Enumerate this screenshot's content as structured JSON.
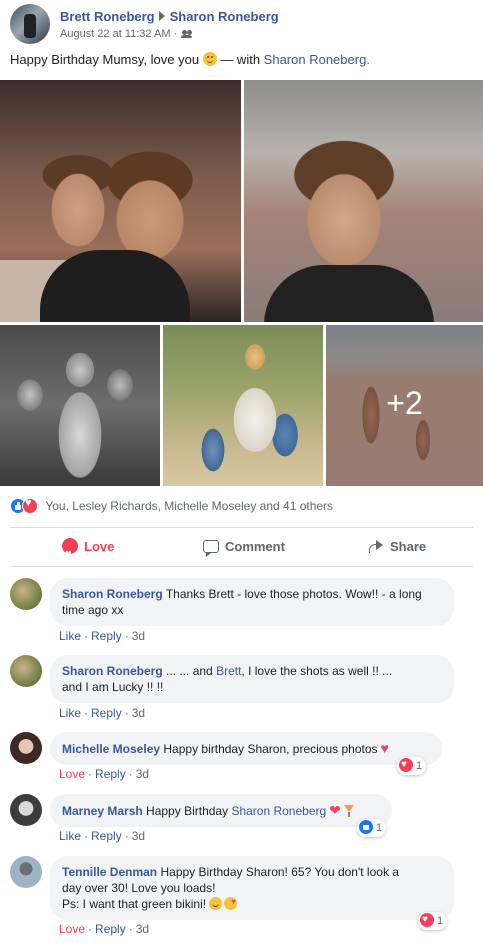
{
  "post": {
    "author": "Brett Roneberg",
    "recipient": "Sharon Roneberg",
    "timestamp": "August 22 at 11:32 AM",
    "audience_icon": "friends-icon",
    "message": "Happy Birthday Mumsy, love you",
    "with_prefix": "— with",
    "tagged": "Sharon Roneberg",
    "tagged_suffix": ".",
    "more_photos": "+2"
  },
  "reactions": {
    "summary": "You, Lesley Richards, Michelle Moseley and 41 others"
  },
  "actions": {
    "love": "Love",
    "comment": "Comment",
    "share": "Share"
  },
  "comments": [
    {
      "author": "Sharon Roneberg",
      "text": "Thanks Brett - love those photos. Wow!! - a long time ago xx",
      "like": "Like",
      "reply": "Reply",
      "time": "3d"
    },
    {
      "author": "Sharon Roneberg",
      "text_before": "... ... and",
      "mention": "Brett",
      "text_after": ", I love the shots as well !! ...",
      "text_line2": "and I am Lucky !! !!",
      "like": "Like",
      "reply": "Reply",
      "time": "3d"
    },
    {
      "author": "Michelle Moseley",
      "text": "Happy birthday Sharon, precious photos",
      "like": "Love",
      "reply": "Reply",
      "time": "3d",
      "reaction_count": "1"
    },
    {
      "author": "Marney Marsh",
      "text": "Happy Birthday",
      "mention": "Sharon Roneberg",
      "like": "Like",
      "reply": "Reply",
      "time": "3d",
      "reaction_count": "1"
    },
    {
      "author": "Tennille Denman",
      "text": "Happy Birthday Sharon! 65? You don't look a",
      "text_line2": "day over 30! Love you loads!",
      "text_line3": "Ps: I want that green bikini!",
      "like": "Love",
      "reply": "Reply",
      "time": "3d",
      "reaction_count": "1"
    }
  ],
  "colors": {
    "link": "#385898",
    "love": "#f33e58",
    "like": "#1877f2",
    "muted": "#606770",
    "bubble": "#f2f3f5"
  }
}
